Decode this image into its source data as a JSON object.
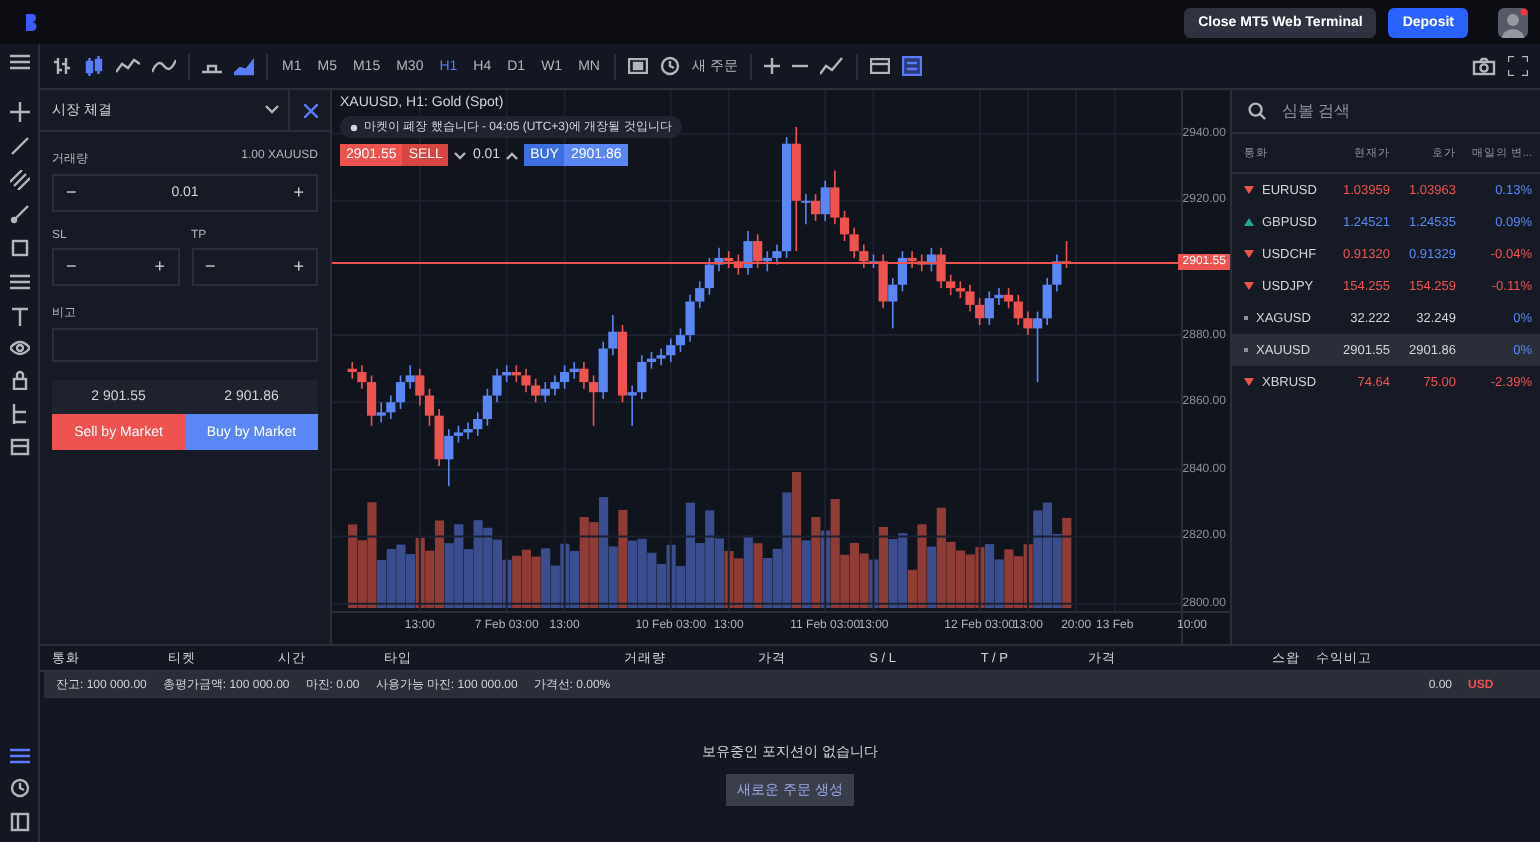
{
  "top_bar": {
    "buttons": [
      {
        "label": "Close MT5 Web Terminal",
        "kind": "secondary"
      },
      {
        "label": "Deposit",
        "kind": "primary"
      }
    ]
  },
  "toolbar": {
    "timeframes": [
      {
        "label": "M1",
        "selected": false
      },
      {
        "label": "M5",
        "selected": false
      },
      {
        "label": "M15",
        "selected": false
      },
      {
        "label": "M30",
        "selected": false
      },
      {
        "label": "H1",
        "selected": true
      },
      {
        "label": "H4",
        "selected": false
      },
      {
        "label": "D1",
        "selected": false
      },
      {
        "label": "W1",
        "selected": false
      },
      {
        "label": "MN",
        "selected": false
      }
    ],
    "new_order": "새 주문"
  },
  "order_panel": {
    "title": "시장 체결",
    "volume_label": "거래량",
    "volume_hint": "1.00 XAUUSD",
    "volume_stepper": {
      "minus": "−",
      "value": "0.01",
      "plus": "+"
    },
    "sl_label": "SL",
    "sl_stepper": {
      "minus": "−",
      "plus": "+"
    },
    "tp_label": "TP",
    "tp_stepper": {
      "minus": "−",
      "plus": "+"
    },
    "comment_label": "비고",
    "bid": "2 901.55",
    "ask": "2 901.86",
    "sell_button": "Sell by Market",
    "buy_button": "Buy by Market"
  },
  "chart": {
    "title": "XAUUSD, H1: Gold (Spot)",
    "notice": "마켓이 폐장 했습니다 - 04:05 (UTC+3)에 개장될 것입니다",
    "sell_price": "2901.55",
    "sell_label": "SELL",
    "lot": "0.01",
    "buy_label": "BUY",
    "buy_price": "2901.86",
    "current_price": "2901.55",
    "chart_data": {
      "type": "candlestick",
      "categories": [
        null,
        null,
        null,
        null,
        null,
        null,
        null,
        null,
        "13:00",
        null,
        null,
        null,
        null,
        null,
        null,
        null,
        null,
        "7 Feb 03:00",
        null,
        null,
        null,
        null,
        null,
        "13:00",
        null,
        null,
        null,
        null,
        null,
        null,
        null,
        null,
        null,
        null,
        "10 Feb 03:00",
        null,
        null,
        null,
        null,
        null,
        "13:00",
        null,
        null,
        null,
        null,
        null,
        null,
        null,
        null,
        null,
        "11 Feb 03:00",
        null,
        null,
        null,
        null,
        "13:00",
        null,
        null,
        null,
        null,
        null,
        null,
        null,
        null,
        null,
        null,
        "12 Feb 03:00",
        null,
        null,
        null,
        null,
        "13:00",
        null,
        null,
        null,
        null,
        "20:00",
        null,
        null,
        null,
        "13 Feb",
        null,
        null,
        null,
        null,
        null,
        null,
        null,
        "10:00"
      ],
      "ohlc": [
        null,
        [
          2870,
          2872,
          2867,
          2869
        ],
        [
          2869,
          2871,
          2864,
          2866
        ],
        [
          2866,
          2868,
          2853,
          2856
        ],
        [
          2856,
          2860,
          2854,
          2857
        ],
        [
          2857,
          2862,
          2855,
          2860
        ],
        [
          2860,
          2868,
          2858,
          2866
        ],
        [
          2866,
          2871,
          2864,
          2868
        ],
        [
          2868,
          2870,
          2859,
          2862
        ],
        [
          2862,
          2864,
          2853,
          2856
        ],
        [
          2856,
          2858,
          2841,
          2843
        ],
        [
          2843,
          2852,
          2835,
          2850
        ],
        [
          2850,
          2853,
          2848,
          2851
        ],
        [
          2851,
          2854,
          2849,
          2852
        ],
        [
          2852,
          2857,
          2850,
          2855
        ],
        [
          2855,
          2864,
          2853,
          2862
        ],
        [
          2862,
          2870,
          2860,
          2868
        ],
        [
          2868,
          2871,
          2866,
          2869
        ],
        [
          2869,
          2871,
          2866,
          2868
        ],
        [
          2868,
          2870,
          2863,
          2865
        ],
        [
          2865,
          2867,
          2860,
          2862
        ],
        [
          2862,
          2866,
          2860,
          2864
        ],
        [
          2864,
          2868,
          2862,
          2866
        ],
        [
          2866,
          2871,
          2864,
          2869
        ],
        [
          2869,
          2872,
          2867,
          2870
        ],
        [
          2870,
          2872,
          2864,
          2866
        ],
        [
          2866,
          2868,
          2853,
          2863
        ],
        [
          2863,
          2878,
          2861,
          2876
        ],
        [
          2876,
          2886,
          2874,
          2881
        ],
        [
          2881,
          2883,
          2860,
          2862
        ],
        [
          2862,
          2865,
          2853,
          2863
        ],
        [
          2863,
          2874,
          2861,
          2872
        ],
        [
          2872,
          2875,
          2870,
          2873
        ],
        [
          2873,
          2876,
          2871,
          2874
        ],
        [
          2874,
          2879,
          2872,
          2877
        ],
        [
          2877,
          2882,
          2875,
          2880
        ],
        [
          2880,
          2892,
          2878,
          2890
        ],
        [
          2890,
          2896,
          2888,
          2894
        ],
        [
          2894,
          2903,
          2892,
          2901
        ],
        [
          2901,
          2906,
          2899,
          2903
        ],
        [
          2903,
          2905,
          2900,
          2902
        ],
        [
          2902,
          2904,
          2898,
          2900
        ],
        [
          2900,
          2911,
          2898,
          2908
        ],
        [
          2908,
          2910,
          2900,
          2902
        ],
        [
          2902,
          2905,
          2899,
          2903
        ],
        [
          2903,
          2907,
          2901,
          2905
        ],
        [
          2905,
          2939,
          2903,
          2937
        ],
        [
          2937,
          2942,
          2905,
          2920
        ],
        [
          2920,
          2922,
          2913,
          2920
        ],
        [
          2920,
          2922,
          2914,
          2916
        ],
        [
          2916,
          2926,
          2914,
          2924
        ],
        [
          2924,
          2929,
          2913,
          2915
        ],
        [
          2915,
          2917,
          2908,
          2910
        ],
        [
          2910,
          2912,
          2903,
          2905
        ],
        [
          2905,
          2907,
          2900,
          2902
        ],
        [
          2902,
          2904,
          2900,
          2902
        ],
        [
          2902,
          2904,
          2888,
          2890
        ],
        [
          2890,
          2897,
          2882,
          2895
        ],
        [
          2895,
          2905,
          2893,
          2903
        ],
        [
          2903,
          2905,
          2900,
          2902
        ],
        [
          2902,
          2904,
          2899,
          2901
        ],
        [
          2901,
          2906,
          2899,
          2904
        ],
        [
          2904,
          2906,
          2894,
          2896
        ],
        [
          2896,
          2898,
          2892,
          2894
        ],
        [
          2894,
          2896,
          2891,
          2893
        ],
        [
          2893,
          2895,
          2887,
          2889
        ],
        [
          2889,
          2891,
          2883,
          2885
        ],
        [
          2885,
          2893,
          2883,
          2891
        ],
        [
          2891,
          2894,
          2889,
          2892
        ],
        [
          2892,
          2894,
          2888,
          2890
        ],
        [
          2890,
          2892,
          2883,
          2885
        ],
        [
          2885,
          2887,
          2880,
          2882
        ],
        [
          2882,
          2887,
          2866,
          2885
        ],
        [
          2885,
          2897,
          2883,
          2895
        ],
        [
          2895,
          2904,
          2893,
          2902
        ],
        [
          2902,
          2908,
          2900,
          2901.5
        ],
        null,
        null,
        null,
        null,
        null,
        null,
        null,
        null,
        null,
        null,
        null,
        null,
        null
      ],
      "ylim": [
        2788,
        2953
      ],
      "grid": true,
      "yticks": [
        {
          "value": 2940,
          "label": "2940.00"
        },
        {
          "value": 2920,
          "label": "2920.00"
        },
        {
          "value": 2880,
          "label": "2880.00"
        },
        {
          "value": 2860,
          "label": "2860.00"
        },
        {
          "value": 2840,
          "label": "2840.00"
        },
        {
          "value": 2820,
          "label": "2820.00"
        },
        {
          "value": 2800,
          "label": "2800.00"
        }
      ]
    }
  },
  "watchlist": {
    "search_placeholder": "심볼 검색",
    "columns": [
      "통화",
      "현재가",
      "호가",
      "매일의 변..."
    ],
    "rows": [
      {
        "symbol": "EURUSD",
        "kind": "falling",
        "color": "#ef5350",
        "bid": {
          "text": "1.03959",
          "color": "#ef5350"
        },
        "ask": {
          "text": "1.03963",
          "color": "#ef5350"
        },
        "change": {
          "text": "0.13%",
          "color": "#5b86f5"
        },
        "selected": false
      },
      {
        "symbol": "GBPUSD",
        "kind": "rising",
        "color": "#26a69a",
        "bid": {
          "text": "1.24521",
          "color": "#5b86f5"
        },
        "ask": {
          "text": "1.24535",
          "color": "#5b86f5"
        },
        "change": {
          "text": "0.09%",
          "color": "#5b86f5"
        },
        "selected": false
      },
      {
        "symbol": "USDCHF",
        "kind": "falling",
        "color": "#ef5350",
        "bid": {
          "text": "0.91320",
          "color": "#ef5350"
        },
        "ask": {
          "text": "0.91329",
          "color": "#5b86f5"
        },
        "change": {
          "text": "-0.04%",
          "color": "#ef5350"
        },
        "selected": false
      },
      {
        "symbol": "USDJPY",
        "kind": "falling",
        "color": "#ef5350",
        "bid": {
          "text": "154.255",
          "color": "#ef5350"
        },
        "ask": {
          "text": "154.259",
          "color": "#ef5350"
        },
        "change": {
          "text": "-0.11%",
          "color": "#ef5350"
        },
        "selected": false
      },
      {
        "symbol": "XAGUSD",
        "kind": "flat",
        "color": "#8d909a",
        "bid": {
          "text": "32.222",
          "color": "#d1d4dc"
        },
        "ask": {
          "text": "32.249",
          "color": "#d1d4dc"
        },
        "change": {
          "text": "0%",
          "color": "#5b86f5"
        },
        "selected": false
      },
      {
        "symbol": "XAUUSD",
        "kind": "flat",
        "color": "#8d909a",
        "bid": {
          "text": "2901.55",
          "color": "#d1d4dc"
        },
        "ask": {
          "text": "2901.86",
          "color": "#d1d4dc"
        },
        "change": {
          "text": "0%",
          "color": "#5b86f5"
        },
        "selected": true
      },
      {
        "symbol": "XBRUSD",
        "kind": "falling",
        "color": "#ef5350",
        "bid": {
          "text": "74.64",
          "color": "#ef5350"
        },
        "ask": {
          "text": "75.00",
          "color": "#ef5350"
        },
        "change": {
          "text": "-2.39%",
          "color": "#ef5350"
        },
        "selected": false
      }
    ]
  },
  "positions": {
    "columns": [
      "통화",
      "티켓",
      "시간",
      "타입",
      "거래량",
      "가격",
      "S / L",
      "T / P",
      "가격",
      "스왑",
      "수익",
      "비고"
    ],
    "summary": [
      "잔고: 100 000.00",
      "총평가금액: 100 000.00",
      "마진: 0.00",
      "사용가능 마진: 100 000.00",
      "가격선: 0.00%"
    ],
    "profit": "0.00",
    "currency": "USD",
    "empty_message": "보유중인 포지션이 없습니다",
    "create_button": "새로운 주문 생성"
  }
}
